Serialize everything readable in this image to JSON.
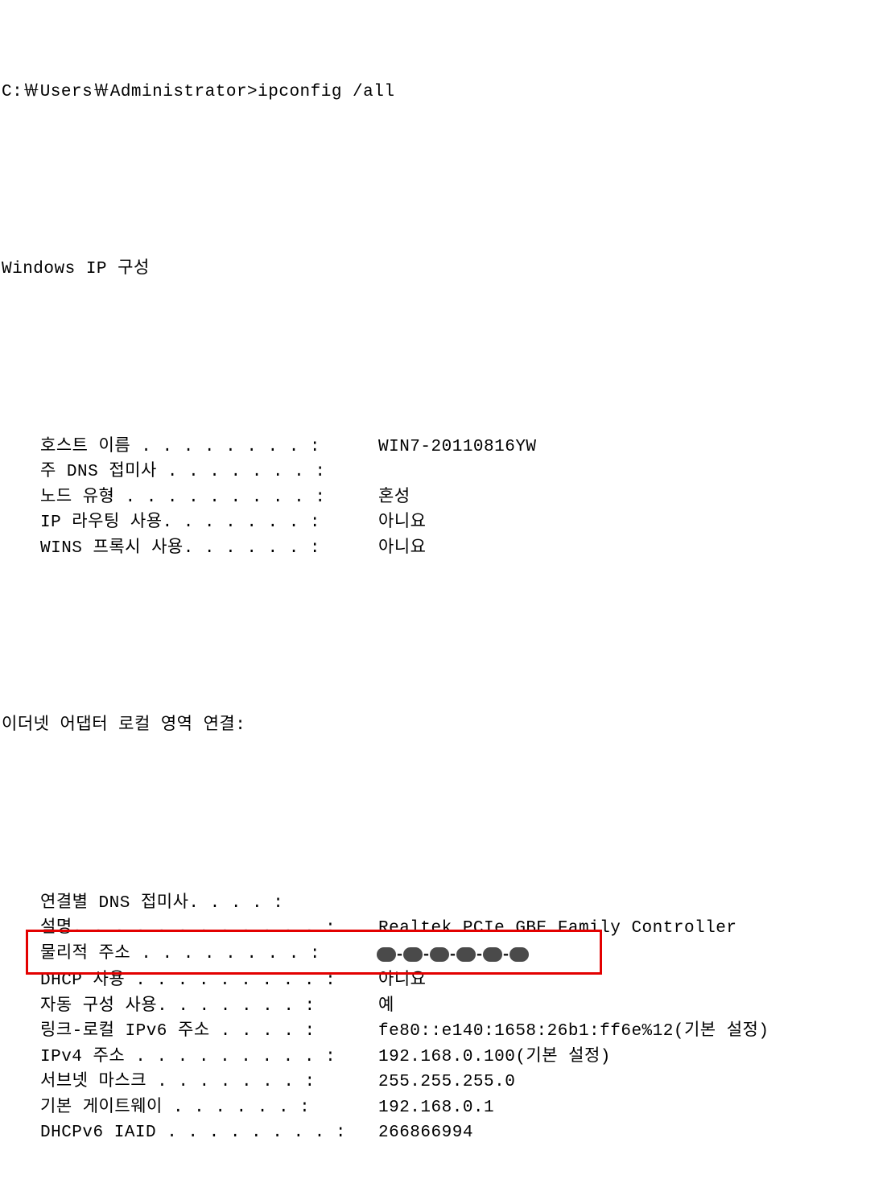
{
  "prompt": "C:￦Users￦Administrator>ipconfig /all",
  "section_ip_config": "Windows IP 구성",
  "ip_config": [
    {
      "label": "호스트 이름 . . . . . . . . : ",
      "value": "WIN7-20110816YW"
    },
    {
      "label": "주 DNS 접미사 . . . . . . . : ",
      "value": ""
    },
    {
      "label": "노드 유형 . . . . . . . . . : ",
      "value": "혼성"
    },
    {
      "label": "IP 라우팅 사용. . . . . . . : ",
      "value": "아니요"
    },
    {
      "label": "WINS 프록시 사용. . . . . . : ",
      "value": "아니요"
    }
  ],
  "section_adapter": "이더넷 어댑터 로컬 영역 연결:",
  "adapter": [
    {
      "label": "연결별 DNS 접미사. . . . :",
      "value": ""
    },
    {
      "label": "설명. . . . . . . . . . . . : ",
      "value": "Realtek PCIe GBE Family Controller"
    },
    {
      "label": "물리적 주소 . . . . . . . . : ",
      "value": "",
      "redacted": true
    },
    {
      "label": "DHCP 사용 . . . . . . . . . : ",
      "value": "아니요"
    },
    {
      "label": "자동 구성 사용. . . . . . . : ",
      "value": "예"
    },
    {
      "label": "링크-로컬 IPv6 주소 . . . . : ",
      "value": "fe80::e140:1658:26b1:ff6e%12(기본 설정)"
    },
    {
      "label": "IPv4 주소 . . . . . . . . . : ",
      "value": "192.168.0.100(기본 설정)"
    },
    {
      "label": "서브넷 마스크 . . . . . . . : ",
      "value": "255.255.255.0"
    },
    {
      "label": "기본 게이트웨이 . . . . . . : ",
      "value": "192.168.0.1"
    },
    {
      "label": "DHCPv6 IAID . . . . . . . . : ",
      "value": "266866994"
    }
  ],
  "highlight_row_index": 2
}
